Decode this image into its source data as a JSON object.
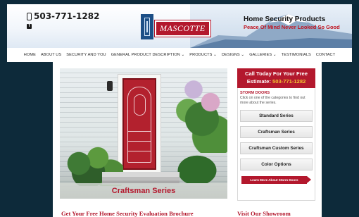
{
  "header": {
    "phone": "503-771-1282",
    "logo_text": "MASCOTTE",
    "tagline_title": "Home Security Products",
    "tagline_sub": "Peace Of Mind Never Looked So Good",
    "icons": {
      "phone": "phone-icon",
      "social": "facebook-icon",
      "logo": "mascotte-door-logo"
    }
  },
  "nav": {
    "items": [
      "HOME",
      "ABOUT US",
      "SECURITY AND YOU",
      "GENERAL PRODUCT DESCRIPTION ⌄",
      "PRODUCTS ⌄",
      "DESIGNS ⌄",
      "GALLERIES ⌄",
      "TESTIMONIALS",
      "CONTACT"
    ]
  },
  "hero": {
    "caption": "Craftsman Series"
  },
  "sidebar": {
    "call_line1": "Call Today For Your Free",
    "call_line2_prefix": "Estimate: ",
    "call_number": "503-771-1282",
    "section_title": "STORM DOORS",
    "section_desc": "Click on one of the categories to find out more about the series.",
    "series": [
      "Standard Series",
      "Craftsman Series",
      "Craftsman Custom Series",
      "Color Options"
    ],
    "learn_more": "Learn More About Storm Doors"
  },
  "bottom": {
    "left_heading": "Get Your Free Home Security Evaluation Brochure",
    "right_heading": "Visit Our Showroom"
  },
  "colors": {
    "brand_red": "#b3182d",
    "highlight_yellow": "#f2c230",
    "page_background": "#0d2a3a"
  }
}
